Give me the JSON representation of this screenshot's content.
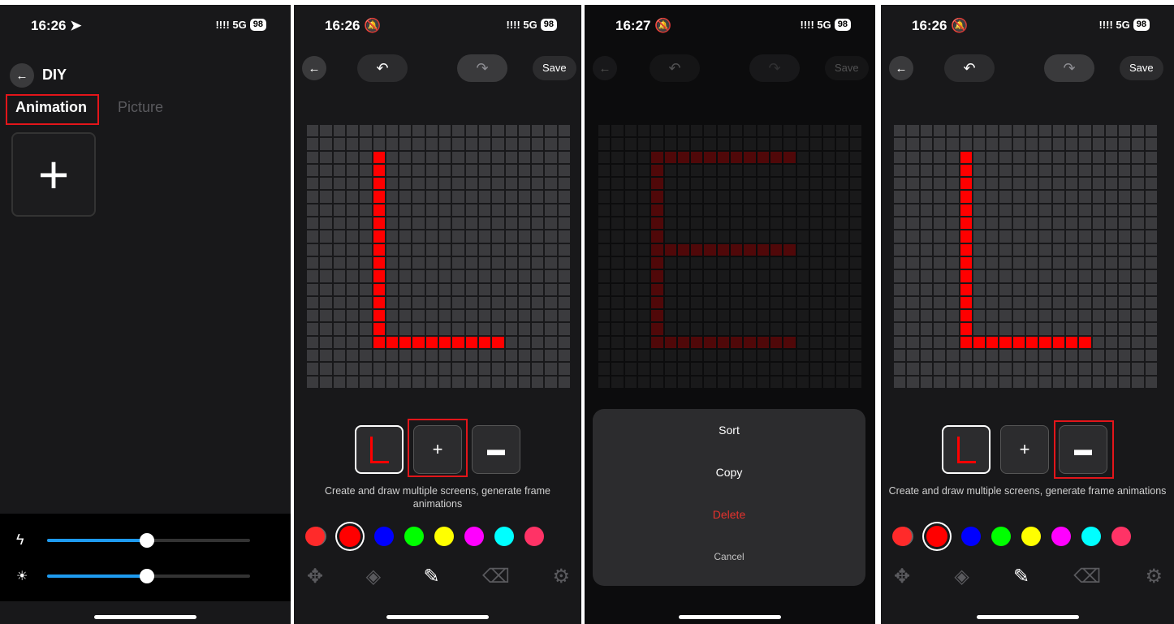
{
  "status": [
    {
      "time": "16:26",
      "glyph": "➤",
      "signal": "!!!! 5G",
      "battery": "98"
    },
    {
      "time": "16:26",
      "glyph": "🔕",
      "signal": "!!!! 5G",
      "battery": "98"
    },
    {
      "time": "16:27",
      "glyph": "🔕",
      "signal": "!!!! 5G",
      "battery": "98"
    },
    {
      "time": "16:26",
      "glyph": "🔕",
      "signal": "!!!! 5G",
      "battery": "98"
    }
  ],
  "diy": {
    "title": "DIY",
    "tabs": [
      {
        "label": "Animation",
        "active": true
      },
      {
        "label": "Picture",
        "active": false
      }
    ],
    "add_glyph": "+",
    "sliders": [
      {
        "icon": "lightning-icon",
        "glyph": "ϟ",
        "value": 0.5
      },
      {
        "icon": "brightness-icon",
        "glyph": "☀",
        "value": 0.5
      }
    ]
  },
  "editor": {
    "back_glyph": "←",
    "undo_glyph": "↶",
    "redo_glyph": "↷",
    "save_label": "Save",
    "add_frame_glyph": "+",
    "folder_glyph": "▬",
    "hint": "Create and draw multiple screens, generate frame animations",
    "colors": [
      "#ff0000",
      "#0000ff",
      "#00ff00",
      "#ffff00",
      "#ff00ff",
      "#00ffff",
      "#ff3366"
    ],
    "selected_color": "#ff0000",
    "palette_icon": "palette-icon",
    "tools": [
      {
        "name": "move-icon",
        "glyph": "✥"
      },
      {
        "name": "fill-icon",
        "glyph": "◈"
      },
      {
        "name": "brush-icon",
        "glyph": "✎"
      },
      {
        "name": "eraser-icon",
        "glyph": "⌫"
      },
      {
        "name": "settings-icon",
        "glyph": "⚙"
      }
    ],
    "active_tool": "brush-icon"
  },
  "menu": {
    "options": [
      "Sort",
      "Copy",
      "Delete"
    ],
    "cancel": "Cancel"
  }
}
